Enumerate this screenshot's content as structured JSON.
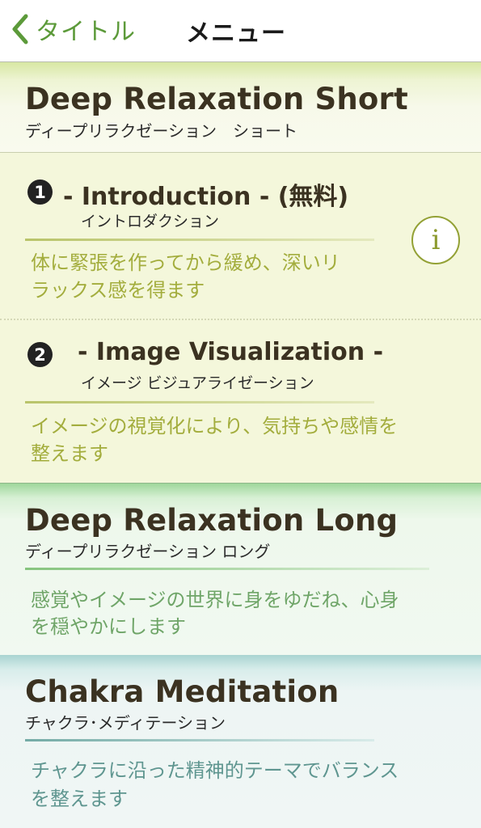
{
  "nav": {
    "back_label": "タイトル",
    "title": "メニュー"
  },
  "sections": [
    {
      "title": "Deep Relaxation Short",
      "subtitle": "ディープリラクゼーション　ショート",
      "items": [
        {
          "number": "1",
          "title": "- Introduction - (無料)",
          "subtitle": "イントロダクション",
          "description_lines": [
            "体に緊張を作ってから緩め、深いリ",
            "ラックス感を得ます"
          ]
        },
        {
          "number": "2",
          "title": "- Image Visualization -",
          "subtitle": "イメージ ビジュアライゼーション",
          "description_lines": [
            "イメージの視覚化により、気持ちや感情を",
            "整えます"
          ]
        }
      ],
      "info_icon": "i"
    },
    {
      "title": "Deep Relaxation Long",
      "subtitle": "ディープリラクゼーション ロング",
      "description_lines": [
        "感覚やイメージの世界に身をゆだね、心身",
        "を穏やかにします"
      ]
    },
    {
      "title": "Chakra Meditation",
      "subtitle": "チャクラ･メディテーション",
      "description_lines": [
        "チャクラに沿った精神的テーマでバランス",
        "を整えます"
      ]
    }
  ],
  "colors": {
    "accent_green": "#5c9a3a",
    "short_desc": "#a3ad3d",
    "long_desc": "#6fa568",
    "chakra_desc": "#5f9690"
  }
}
